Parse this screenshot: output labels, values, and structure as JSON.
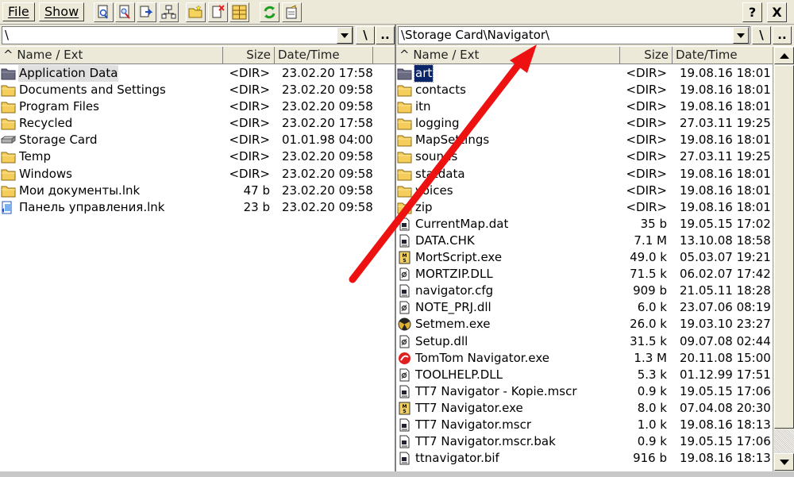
{
  "toolbar": {
    "menus": [
      "File",
      "Show"
    ],
    "icons": [
      "find-file-icon",
      "search-icon",
      "copy-file-icon",
      "network-icon",
      "new-folder-icon",
      "delete-icon",
      "split-view-icon",
      "refresh-icon",
      "properties-icon"
    ],
    "help_label": "?",
    "close_label": "X"
  },
  "left": {
    "path": "\\",
    "backslash_label": "\\",
    "up_label": "..",
    "columns": {
      "name": "^ Name / Ext",
      "size": "Size",
      "date": "Date/Time"
    },
    "rows": [
      {
        "icon": "folder-open-icon",
        "name": "Application Data",
        "size": "<DIR>",
        "date": "23.02.20 17:58",
        "selected": "gray"
      },
      {
        "icon": "folder-icon",
        "name": "Documents and Settings",
        "size": "<DIR>",
        "date": "23.02.20 09:58"
      },
      {
        "icon": "folder-icon",
        "name": "Program Files",
        "size": "<DIR>",
        "date": "23.02.20 09:58"
      },
      {
        "icon": "folder-icon",
        "name": "Recycled",
        "size": "<DIR>",
        "date": "23.02.20 17:58"
      },
      {
        "icon": "storage-card-icon",
        "name": "Storage Card",
        "size": "<DIR>",
        "date": "01.01.98 04:00"
      },
      {
        "icon": "folder-icon",
        "name": "Temp",
        "size": "<DIR>",
        "date": "23.02.20 09:58"
      },
      {
        "icon": "folder-icon",
        "name": "Windows",
        "size": "<DIR>",
        "date": "23.02.20 09:58"
      },
      {
        "icon": "folder-icon",
        "name": "Мои документы.lnk",
        "size": "47 b",
        "date": "23.02.20 09:58"
      },
      {
        "icon": "control-panel-icon",
        "name": "Панель управления.lnk",
        "size": "23 b",
        "date": "23.02.20 09:58"
      }
    ]
  },
  "right": {
    "path": "\\Storage Card\\Navigator\\",
    "backslash_label": "\\",
    "up_label": "..",
    "columns": {
      "name": "^ Name / Ext",
      "size": "Size",
      "date": "Date/Time"
    },
    "rows": [
      {
        "icon": "folder-open-icon",
        "name": "art",
        "size": "<DIR>",
        "date": "19.08.16 18:01",
        "selected": "blue"
      },
      {
        "icon": "folder-icon",
        "name": "contacts",
        "size": "<DIR>",
        "date": "19.08.16 18:01"
      },
      {
        "icon": "folder-icon",
        "name": "itn",
        "size": "<DIR>",
        "date": "19.08.16 18:01"
      },
      {
        "icon": "folder-icon",
        "name": "logging",
        "size": "<DIR>",
        "date": "27.03.11 19:25"
      },
      {
        "icon": "folder-icon",
        "name": "MapSettings",
        "size": "<DIR>",
        "date": "19.08.16 18:01"
      },
      {
        "icon": "folder-icon",
        "name": "sounds",
        "size": "<DIR>",
        "date": "27.03.11 19:25"
      },
      {
        "icon": "folder-icon",
        "name": "statdata",
        "size": "<DIR>",
        "date": "19.08.16 18:01"
      },
      {
        "icon": "folder-icon",
        "name": "voices",
        "size": "<DIR>",
        "date": "19.08.16 18:01"
      },
      {
        "icon": "folder-icon",
        "name": "zip",
        "size": "<DIR>",
        "date": "19.08.16 18:01"
      },
      {
        "icon": "data-file-icon",
        "name": "CurrentMap.dat",
        "size": "35 b",
        "date": "19.05.15 17:02"
      },
      {
        "icon": "data-file-icon",
        "name": "DATA.CHK",
        "size": "7.1 M",
        "date": "13.10.08 18:58"
      },
      {
        "icon": "mortscript-icon",
        "name": "MortScript.exe",
        "size": "49.0 k",
        "date": "05.03.07 19:21"
      },
      {
        "icon": "dll-file-icon",
        "name": "MORTZIP.DLL",
        "size": "71.5 k",
        "date": "06.02.07 17:42"
      },
      {
        "icon": "data-file-icon",
        "name": "navigator.cfg",
        "size": "909 b",
        "date": "21.05.11 18:28"
      },
      {
        "icon": "dll-file-icon",
        "name": "NOTE_PRJ.dll",
        "size": "6.0 k",
        "date": "23.07.06 08:19"
      },
      {
        "icon": "setmem-icon",
        "name": "Setmem.exe",
        "size": "26.0 k",
        "date": "19.03.10 23:27"
      },
      {
        "icon": "dll-file-icon",
        "name": "Setup.dll",
        "size": "31.5 k",
        "date": "09.07.08 02:44"
      },
      {
        "icon": "tomtom-icon",
        "name": "TomTom Navigator.exe",
        "size": "1.3 M",
        "date": "20.11.08 15:00"
      },
      {
        "icon": "dll-file-icon",
        "name": "TOOLHELP.DLL",
        "size": "5.3 k",
        "date": "01.12.99 17:51"
      },
      {
        "icon": "data-file-icon",
        "name": "TT7 Navigator - Kopie.mscr",
        "size": "0.9 k",
        "date": "19.05.15 17:06"
      },
      {
        "icon": "mortscript-icon",
        "name": "TT7 Navigator.exe",
        "size": "8.0 k",
        "date": "07.04.08 20:30"
      },
      {
        "icon": "data-file-icon",
        "name": "TT7 Navigator.mscr",
        "size": "1.0 k",
        "date": "19.08.16 18:13"
      },
      {
        "icon": "data-file-icon",
        "name": "TT7 Navigator.mscr.bak",
        "size": "0.9 k",
        "date": "19.05.15 17:06"
      },
      {
        "icon": "data-file-icon",
        "name": "ttnavigator.bif",
        "size": "916 b",
        "date": "19.08.16 18:13"
      }
    ]
  },
  "annotation": {
    "color": "#ee1111",
    "icon": "red-arrow-icon"
  }
}
